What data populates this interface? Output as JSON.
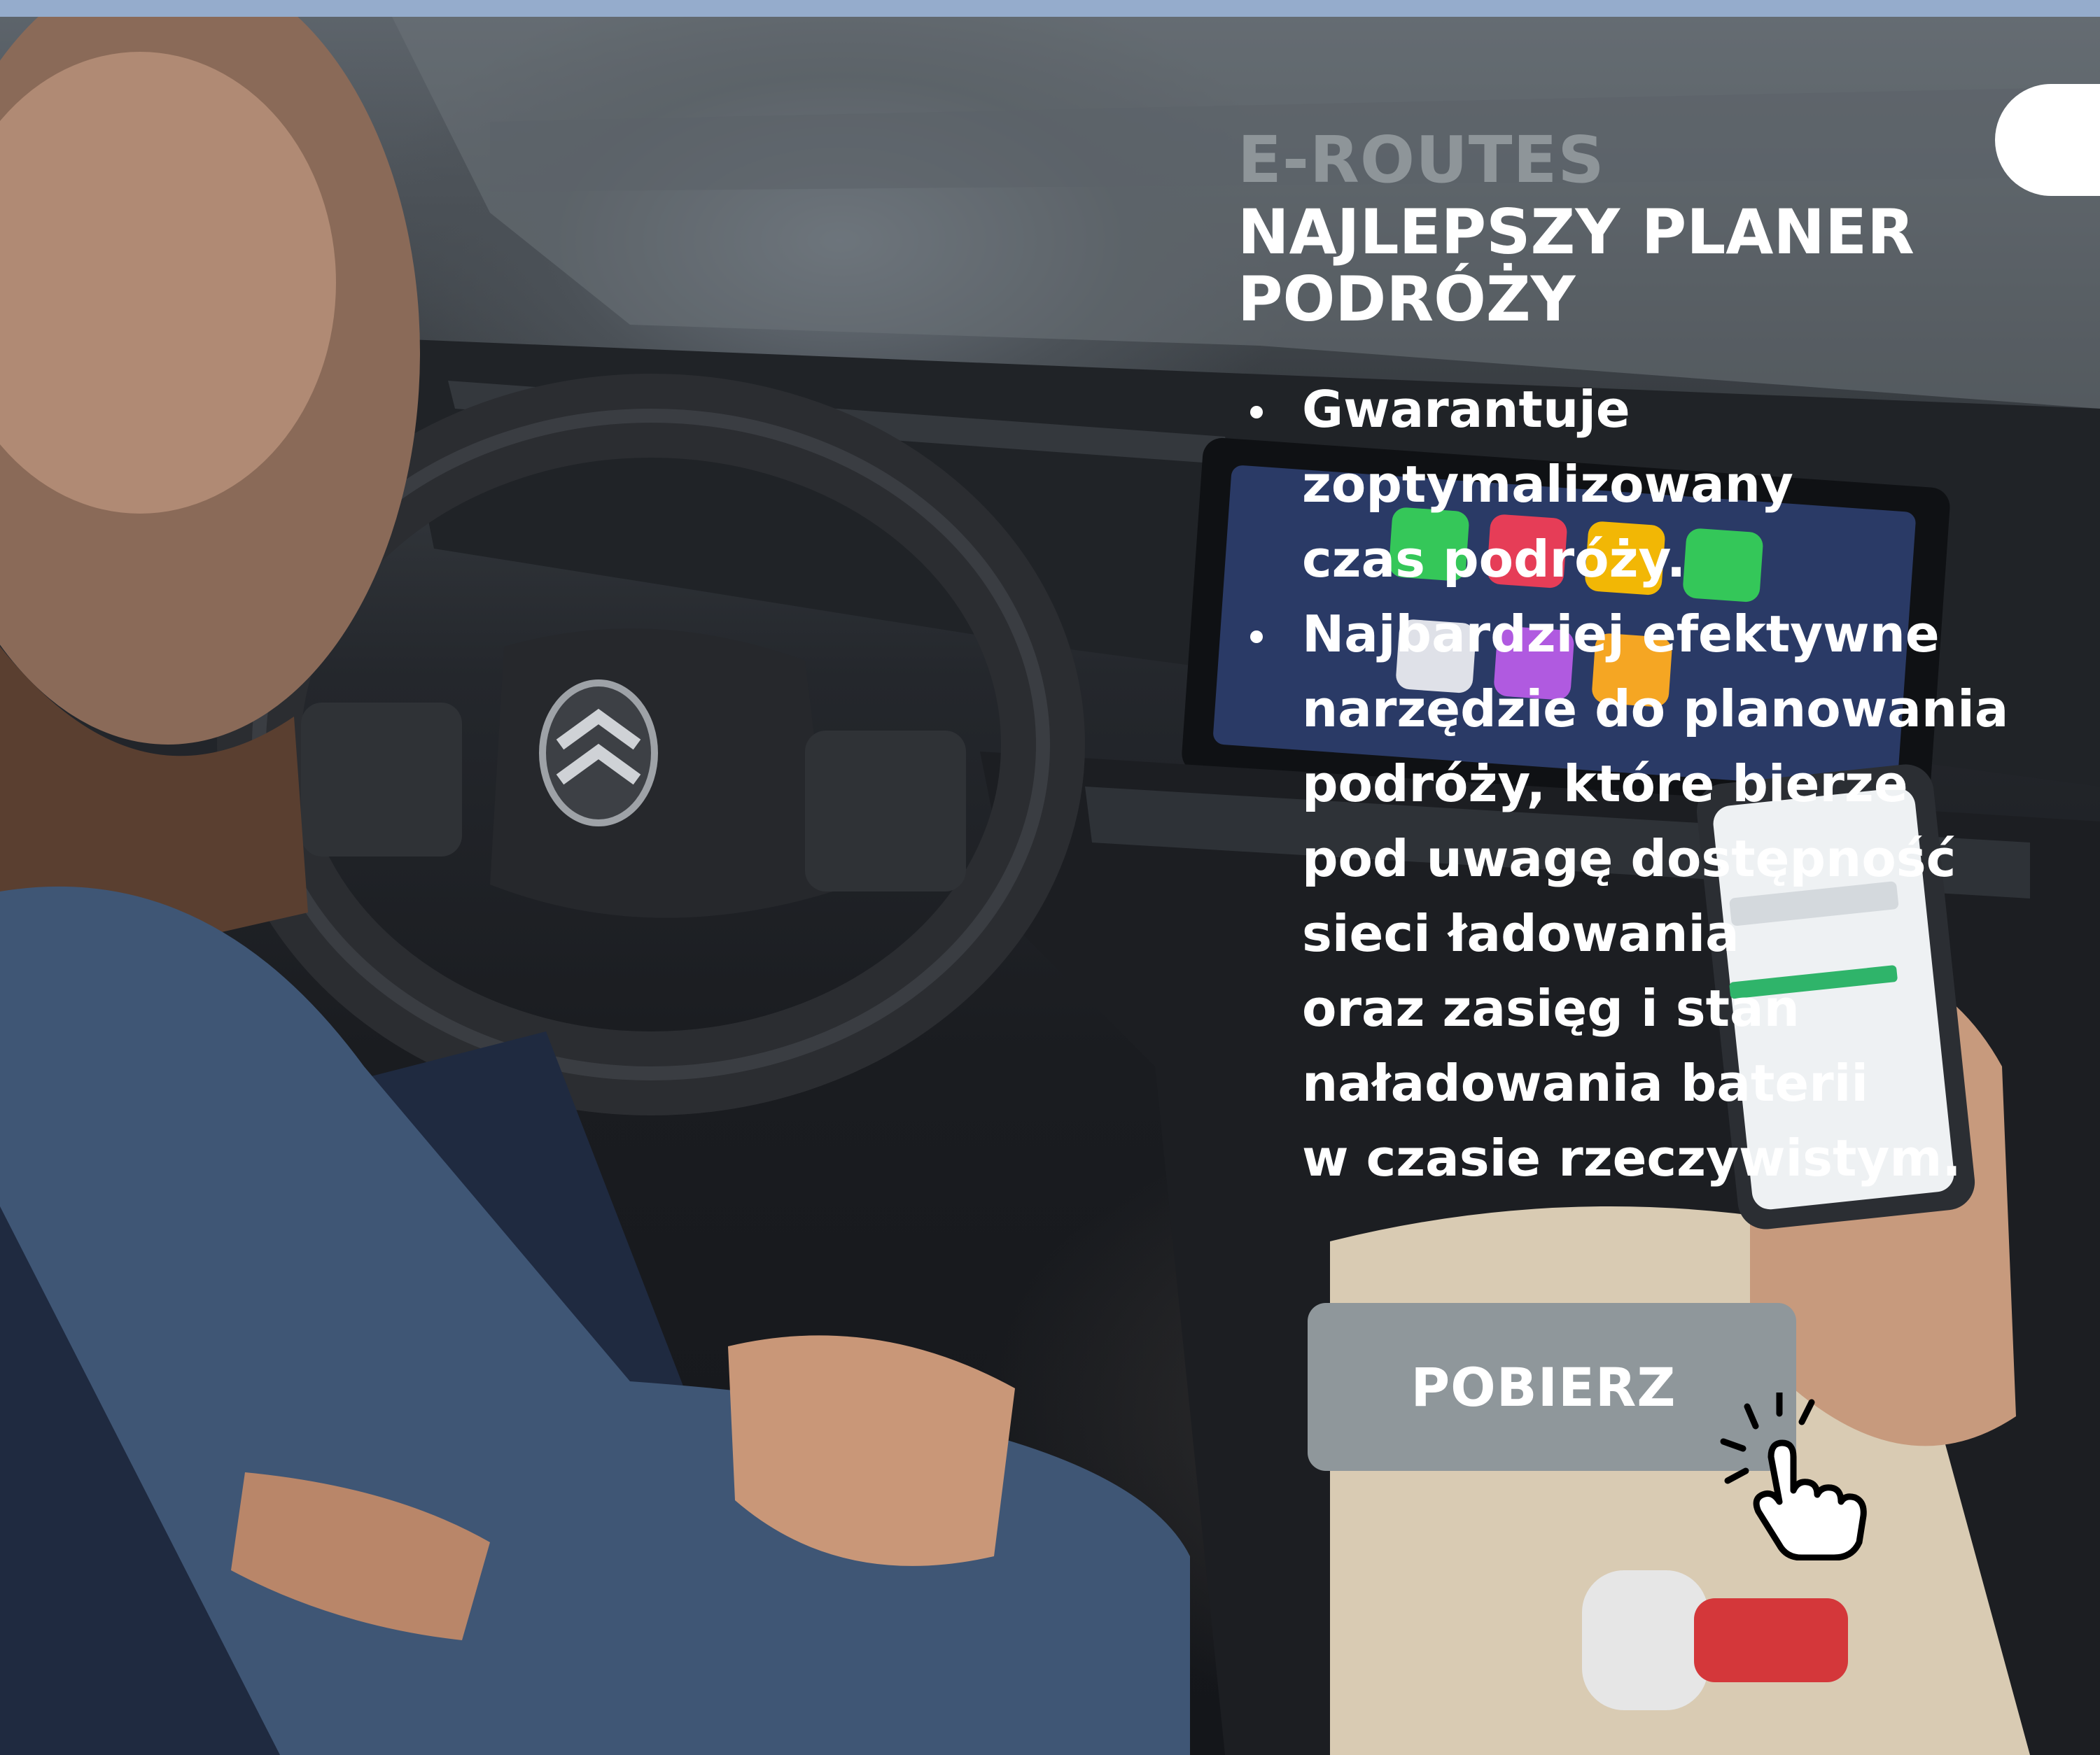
{
  "promo": {
    "kicker": "E-ROUTES",
    "headline_line1": "NAJLEPSZY PLANER",
    "headline_line2": "PODRÓŻY",
    "bullets": [
      {
        "lines": [
          "Gwarantuje",
          "zoptymalizowany",
          "czas podróży."
        ]
      },
      {
        "lines": [
          "Najbardziej efektywne",
          "narzędzie do planowania",
          "podróży, które bierze",
          "pod uwagę dostępność",
          "sieci ładowania",
          "oraz zasięg i stan",
          "naładowania baterii",
          "w czasie rzeczywistym."
        ]
      }
    ],
    "cta_label": "POBIERZ"
  },
  "icons": {
    "cursor": "pointing-hand-icon",
    "brand_logo": "citroen-logo-icon"
  },
  "colors": {
    "top_bar": "#95accc",
    "kicker": "#8e9599",
    "cta_background": "#8f979b",
    "text": "#ffffff"
  }
}
